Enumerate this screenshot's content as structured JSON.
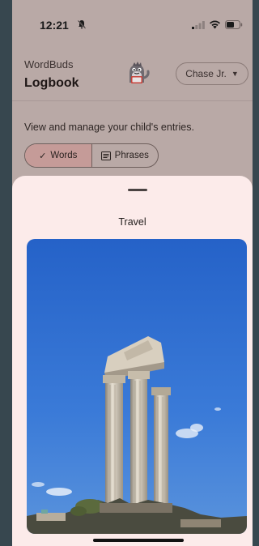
{
  "status_bar": {
    "time": "12:21",
    "icons": [
      "bell-off-icon",
      "signal-icon",
      "wifi-icon",
      "battery-icon"
    ]
  },
  "header": {
    "app_name": "WordBuds",
    "title": "Logbook",
    "mascot_icon": "dinosaur-mascot",
    "child_selector": {
      "selected": "Chase Jr."
    }
  },
  "main": {
    "subtitle": "View and manage your child's entries.",
    "segments": [
      {
        "label": "Words",
        "icon": "check-icon",
        "selected": true
      },
      {
        "label": "Phrases",
        "icon": "list-icon",
        "selected": false
      }
    ]
  },
  "sheet": {
    "title": "Travel",
    "image_subject": "ancient-roman-columns-photo"
  },
  "colors": {
    "sheet_bg": "#fcebea",
    "segment_selected": "#c59b98",
    "sky": "#2f6fd1"
  }
}
